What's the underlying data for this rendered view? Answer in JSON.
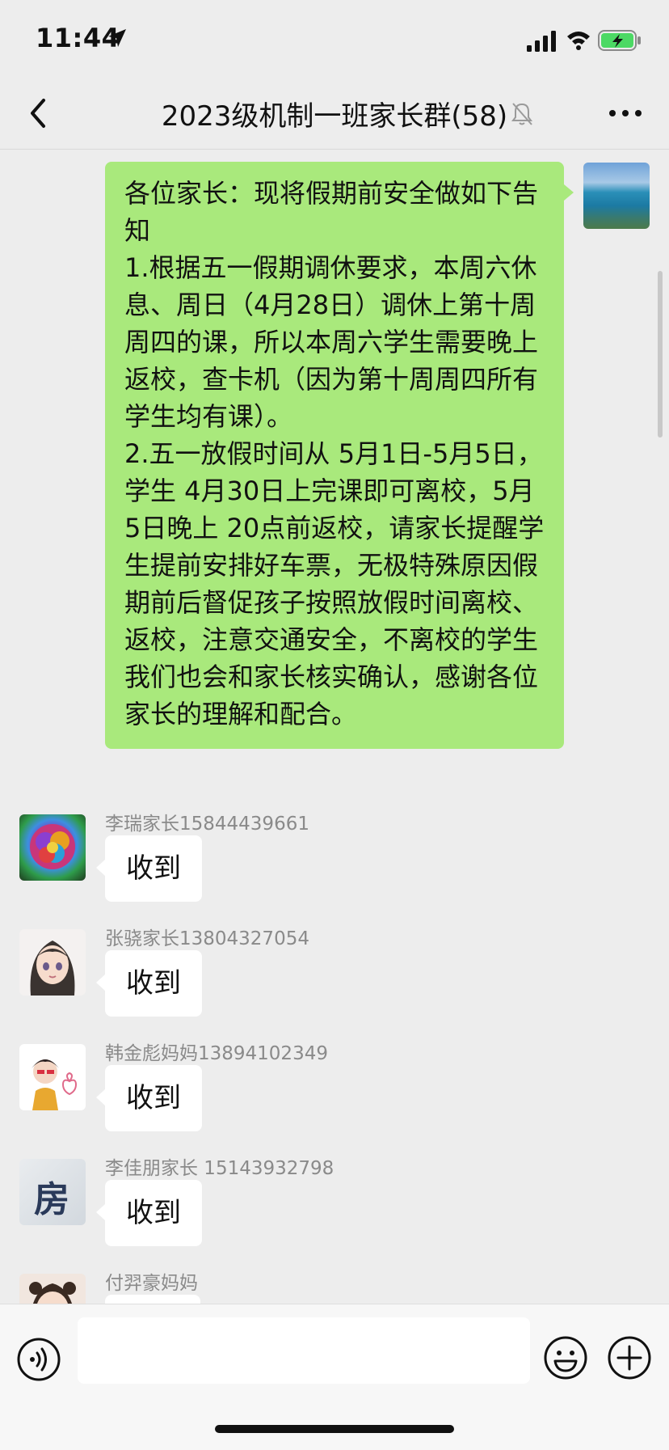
{
  "status_bar": {
    "time": "11:44"
  },
  "nav": {
    "title": "2023级机制一班家长群(58)"
  },
  "outgoing_message": {
    "text": "各位家长：现将假期前安全做如下告知\n1.根据五一假期调休要求，本周六休息、周日（4月28日）调休上第十周周四的课，所以本周六学生需要晚上返校，查卡机（因为第十周周四所有学生均有课）。\n2.五一放假时间从 5月1日-5月5日，学生 4月30日上完课即可离校，5月5日晚上 20点前返校，请家长提醒学生提前安排好车票，无极特殊原因假期前后督促孩子按照放假时间离校、返校，注意交通安全，不离校的学生我们也会和家长核实确认，感谢各位家长的理解和配合。"
  },
  "messages": [
    {
      "sender": "李瑞家长15844439661",
      "text": "收到"
    },
    {
      "sender": "张骁家长13804327054",
      "text": "收到"
    },
    {
      "sender": "韩金彪妈妈13894102349",
      "text": "收到"
    },
    {
      "sender": "李佳朋家长  15143932798",
      "text": "收到"
    },
    {
      "sender": "付羿豪妈妈",
      "text": ""
    }
  ],
  "avatar_text": {
    "fang": "房"
  },
  "icons": {
    "location": "location-arrow-icon",
    "signal": "signal-icon",
    "wifi": "wifi-icon",
    "battery": "battery-charging-icon",
    "back": "chevron-left-icon",
    "mute": "mute-bell-icon",
    "more": "more-dots-icon",
    "voice": "voice-icon",
    "emoji": "emoji-icon",
    "plus": "plus-icon"
  },
  "colors": {
    "outgoing_bubble": "#a9e97c",
    "incoming_bubble": "#ffffff",
    "background": "#ededed",
    "battery": "#4cd964"
  }
}
